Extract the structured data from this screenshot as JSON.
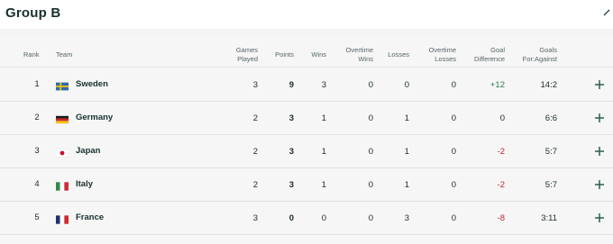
{
  "header": {
    "title": "Group B"
  },
  "columns": {
    "rank": "Rank",
    "team": "Team",
    "games_played_1": "Games",
    "games_played_2": "Played",
    "points": "Points",
    "wins": "Wins",
    "ot_wins_1": "Overtime",
    "ot_wins_2": "Wins",
    "losses": "Losses",
    "ot_losses_1": "Overtime",
    "ot_losses_2": "Losses",
    "gd_1": "Goal",
    "gd_2": "Difference",
    "gfa_1": "Goals",
    "gfa_2": "For:Against"
  },
  "rows": [
    {
      "rank": "1",
      "team": "Sweden",
      "flag": "sweden-flag",
      "gp": "3",
      "pts": "9",
      "w": "3",
      "otw": "0",
      "l": "0",
      "otl": "0",
      "gd": "+12",
      "gfa": "14:2"
    },
    {
      "rank": "2",
      "team": "Germany",
      "flag": "germany-flag",
      "gp": "2",
      "pts": "3",
      "w": "1",
      "otw": "0",
      "l": "1",
      "otl": "0",
      "gd": "0",
      "gfa": "6:6"
    },
    {
      "rank": "3",
      "team": "Japan",
      "flag": "japan-flag",
      "gp": "2",
      "pts": "3",
      "w": "1",
      "otw": "0",
      "l": "1",
      "otl": "0",
      "gd": "-2",
      "gfa": "5:7"
    },
    {
      "rank": "4",
      "team": "Italy",
      "flag": "italy-flag",
      "gp": "2",
      "pts": "3",
      "w": "1",
      "otw": "0",
      "l": "1",
      "otl": "0",
      "gd": "-2",
      "gfa": "5:7"
    },
    {
      "rank": "5",
      "team": "France",
      "flag": "france-flag",
      "gp": "3",
      "pts": "0",
      "w": "0",
      "otw": "0",
      "l": "3",
      "otl": "0",
      "gd": "-8",
      "gfa": "3:11"
    }
  ],
  "colors": {
    "positive": "#2e7a55",
    "negative": "#c0262d",
    "accent": "#2b5e55"
  }
}
